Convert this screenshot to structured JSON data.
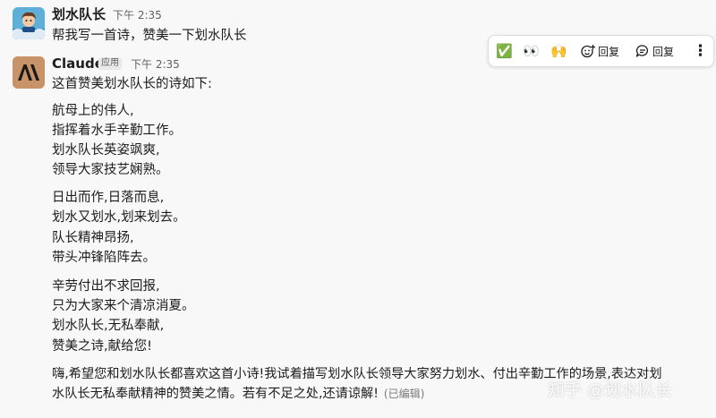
{
  "user_message": {
    "author": "划水队长",
    "time": "下午 2:35",
    "text": "帮我写一首诗，赞美一下划水队长"
  },
  "toolbar": {
    "check_emoji": "✅",
    "eyes_emoji": "👀",
    "raised_hands_emoji": "🙌",
    "reply_label": "回复",
    "thread_label": "回复",
    "more_label": "⋮"
  },
  "claude_message": {
    "author": "Claude",
    "badge": "应用",
    "time": "下午 2:35",
    "intro": "这首赞美划水队长的诗如下:",
    "stanzas": [
      [
        "航母上的伟人,",
        "指挥着水手辛勤工作。",
        "划水队长英姿飒爽,",
        "领导大家技艺娴熟。"
      ],
      [
        "日出而作,日落而息,",
        "划水又划水,划来划去。",
        "队长精神昂扬,",
        "带头冲锋陷阵去。"
      ],
      [
        "辛劳付出不求回报,",
        "只为大家来个清凉消夏。",
        "划水队长,无私奉献,",
        "赞美之诗,献给您!"
      ]
    ],
    "closing": [
      "嗨,希望您和划水队长都喜欢这首小诗!我试着描写划水队长领导大家努力划水、付出辛勤工作的场景,表达对划",
      "水队长无私奉献精神的赞美之情。若有不足之处,还请谅解!"
    ],
    "edited": "(已编辑)"
  },
  "watermark": "知乎 @划水队长",
  "colors": {
    "background": "#f8f8f8",
    "text": "#1d1c1d",
    "muted": "#616061",
    "claude_avatar": "#c9936a"
  }
}
